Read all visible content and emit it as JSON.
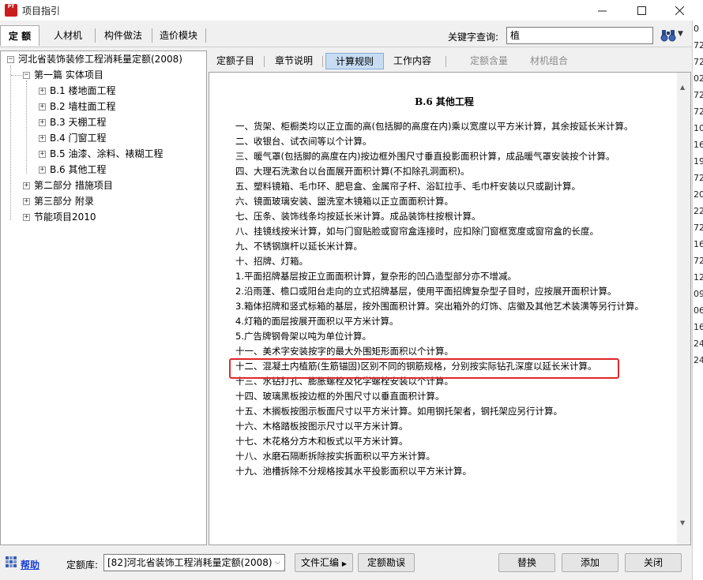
{
  "window": {
    "icon_text": "PT",
    "title": "项目指引"
  },
  "top_tabs": [
    "定 额",
    "人材机",
    "构件做法",
    "造价模块"
  ],
  "search": {
    "label": "关键字查询:",
    "value": "植"
  },
  "tree": {
    "root": "河北省装饰装修工程消耗量定额(2008)",
    "part1": "第一篇 实体项目",
    "children": [
      "B.1 楼地面工程",
      "B.2 墙柱面工程",
      "B.3 天棚工程",
      "B.4 门窗工程",
      "B.5 油漆、涂料、裱糊工程",
      "B.6 其他工程"
    ],
    "part2": "第二部分 措施项目",
    "part3": "第三部分 附录",
    "part4": "节能项目2010"
  },
  "content_tabs": [
    "定额子目",
    "章节说明",
    "计算规则",
    "工作内容",
    "定额含量",
    "材机组合"
  ],
  "document": {
    "title": "B.6 其他工程",
    "lines": [
      "一、货架、柜橱类均以正立面的高(包括脚的高度在内)乘以宽度以平方米计算，其余按延长米计算。",
      "二、收银台、试衣间等以个计算。",
      "三、暖气罩(包括脚的高度在内)按边框外围尺寸垂直投影面积计算，成品暖气罩安装按个计算。",
      "四、大理石洗漱台以台面展开面积计算(不扣除孔洞面积)。",
      "五、塑料镜箱、毛巾环、肥皂盒、金属帘子杆、浴缸拉手、毛巾杆安装以只或副计算。",
      "六、镜面玻璃安装、盥洗室木镜箱以正立面面积计算。",
      "七、压条、装饰线条均按延长米计算。成品装饰柱按根计算。",
      "八、挂镜线按米计算，如与门窗贴脸或窗帘盒连接时，应扣除门窗框宽度或窗帘盒的长度。",
      "九、不锈钢旗杆以延长米计算。",
      "十、招牌、灯箱。",
      "1.平面招牌基层按正立面面积计算，复杂形的凹凸造型部分亦不增减。",
      "2.沿雨蓬、檐口或阳台走向的立式招牌基层，使用平面招牌复杂型子目时，应按展开面积计算。",
      "3.箱体招牌和竖式标箱的基层，按外围面积计算。突出箱外的灯饰、店徽及其他艺术装潢等另行计算。",
      "4.灯箱的面层按展开面积以平方米计算。",
      "5.广告牌钢骨架以吨为单位计算。",
      "十一、美术字安装按字的最大外围矩形面积以个计算。",
      "十二、混凝土内植筋(生筋锚固)区别不同的钢筋规格，分别按实际钻孔深度以延长米计算。",
      "十三、水钻打孔、膨胀螺栓及化学螺栓安装以个计算。",
      "十四、玻璃黑板按边框的外围尺寸以垂直面积计算。",
      "十五、木搁板按图示板面尺寸以平方米计算。如用钢托架者，钢托架应另行计算。",
      "十六、木格踏板按图示尺寸以平方米计算。",
      "十七、木花格分方木和板式以平方米计算。",
      "十八、水磨石隔断拆除按实拆面积以平方米计算。",
      "十九、池槽拆除不分规格按其水平投影面积以平方米计算。"
    ]
  },
  "edge_numbers": [
    "0",
    "72",
    "72",
    "02",
    "72",
    "72",
    "10",
    "16",
    "19",
    "72",
    "20",
    "22",
    "72",
    "16",
    "72",
    "12",
    "09",
    "06",
    "16",
    "24",
    "24"
  ],
  "bottom": {
    "help": "帮助",
    "library_label": "定额库:",
    "library_value": "[82]河北省装饰工程消耗量定额(2008)",
    "btn_files": "文件汇编",
    "btn_errata": "定额勘误",
    "btn_replace": "替换",
    "btn_add": "添加",
    "btn_close": "关闭"
  },
  "colors": {
    "highlight": "#e0282b",
    "active_tab": "#c7dcf3",
    "help_link": "#1a3fd6"
  }
}
